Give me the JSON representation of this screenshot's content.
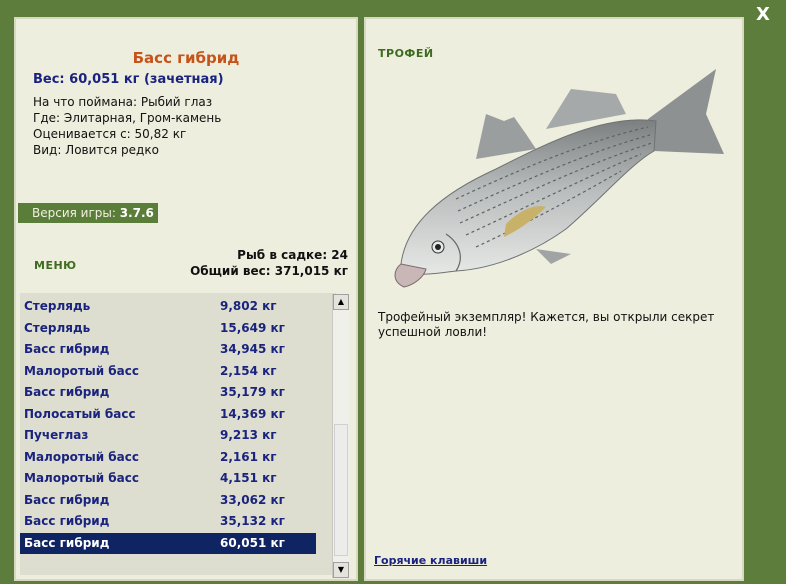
{
  "close_label": "X",
  "fish": {
    "name": "Басс гибрид",
    "weight_line": "Вес: 60,051 кг (зачетная)",
    "caught_on": "На что поймана: Рыбий глаз",
    "location": "Где: Элитарная, Гром-камень",
    "value": "Оценивается с: 50,82 кг",
    "rarity": "Вид: Ловится редко"
  },
  "version": {
    "label": "Версия игры:",
    "number": "3.7.6"
  },
  "menu_label": "МЕНЮ",
  "keepnet": {
    "count_line": "Рыб в садке: 24",
    "total_line": "Общий вес: 371,015 кг"
  },
  "catch_list": [
    {
      "name": "Стерлядь",
      "weight": "9,802 кг"
    },
    {
      "name": "Стерлядь",
      "weight": "15,649 кг"
    },
    {
      "name": "Басс гибрид",
      "weight": "34,945 кг"
    },
    {
      "name": "Малоротый басс",
      "weight": "2,154 кг"
    },
    {
      "name": "Басс гибрид",
      "weight": "35,179 кг"
    },
    {
      "name": "Полосатый басс",
      "weight": "14,369 кг"
    },
    {
      "name": "Пучеглаз",
      "weight": "9,213 кг"
    },
    {
      "name": "Малоротый басс",
      "weight": "2,161 кг"
    },
    {
      "name": "Малоротый басс",
      "weight": "4,151 кг"
    },
    {
      "name": "Басс гибрид",
      "weight": "33,062 кг"
    },
    {
      "name": "Басс гибрид",
      "weight": "35,132 кг"
    },
    {
      "name": "Басс гибрид",
      "weight": "60,051 кг"
    }
  ],
  "trophy_label": "ТРОФЕЙ",
  "trophy_message": "Трофейный экземпляр! Кажется, вы открыли секрет успешной ловли!",
  "hotkeys_label": "Горячие клавиши",
  "colors": {
    "frame": "#5c7d3c",
    "panel": "#eeeedf",
    "list_text": "#1a237e",
    "selection": "#0f2462",
    "fish_title": "#c6531a"
  }
}
